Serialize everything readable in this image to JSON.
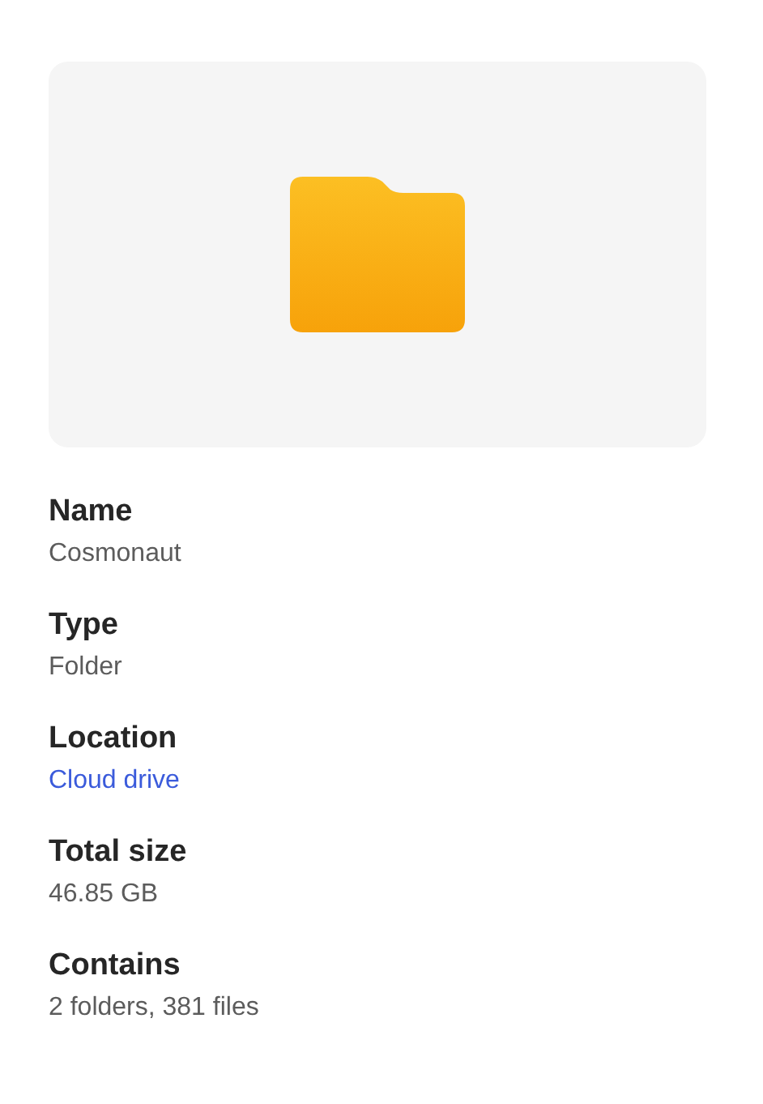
{
  "preview": {
    "kind": "folder"
  },
  "properties": [
    {
      "label": "Name",
      "value": "Cosmonaut",
      "kind": "text"
    },
    {
      "label": "Type",
      "value": "Folder",
      "kind": "text"
    },
    {
      "label": "Location",
      "value": "Cloud drive",
      "kind": "link"
    },
    {
      "label": "Total size",
      "value": "46.85 GB",
      "kind": "text"
    },
    {
      "label": "Contains",
      "value": "2 folders, 381 files",
      "kind": "text"
    }
  ]
}
